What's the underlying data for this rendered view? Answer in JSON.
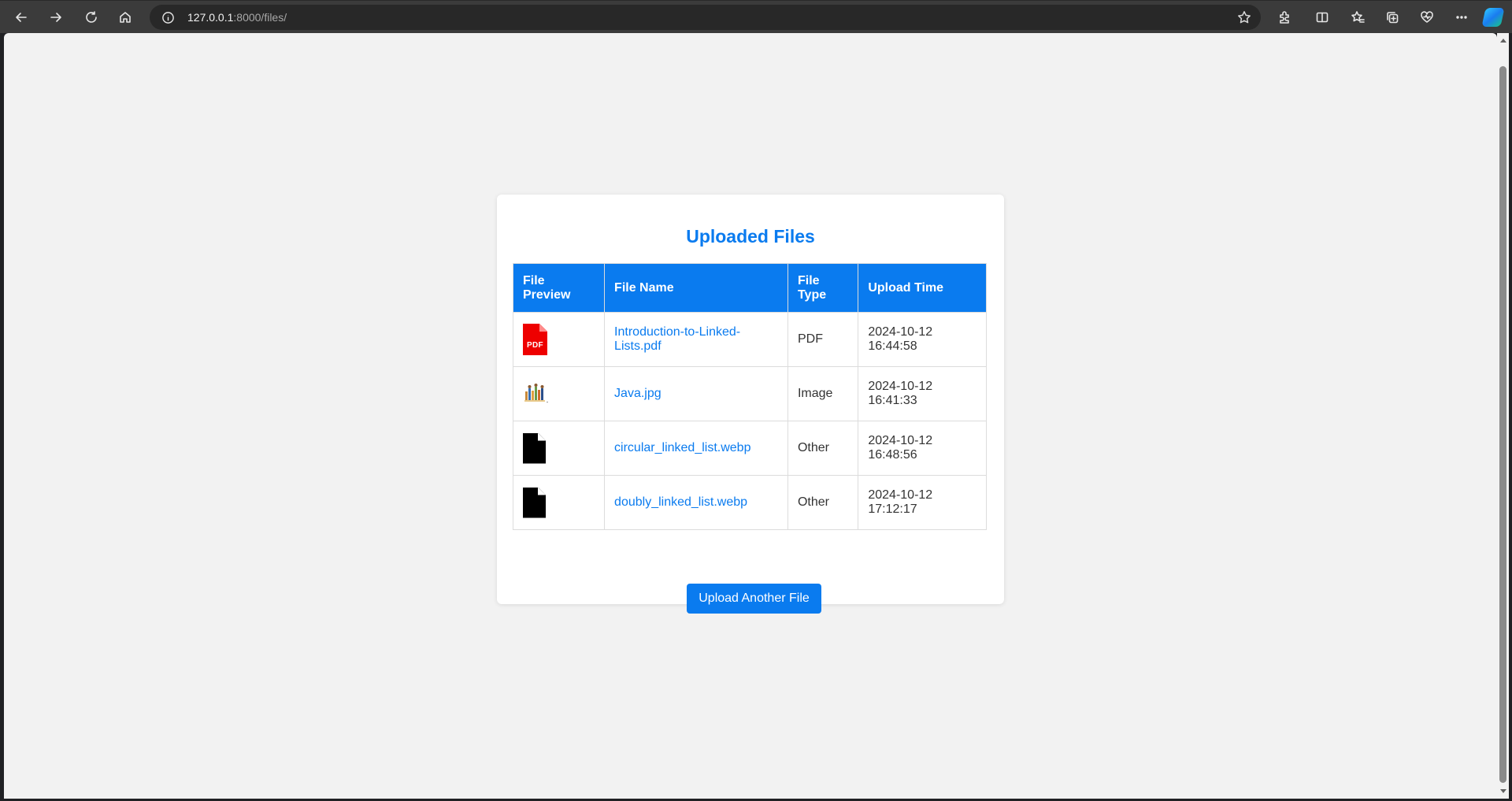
{
  "browser": {
    "url_host": "127.0.0.1",
    "url_rest": ":8000/files/",
    "icons": [
      "back-icon",
      "forward-icon",
      "refresh-icon",
      "home-icon",
      "info-icon",
      "favorite-star-icon",
      "extensions-icon",
      "split-screen-icon",
      "favorites-icon",
      "collections-icon",
      "browser-essentials-icon",
      "more-icon",
      "copilot-icon"
    ]
  },
  "page": {
    "title": "Uploaded Files",
    "columns": [
      "File Preview",
      "File Name",
      "File Type",
      "Upload Time"
    ],
    "rows": [
      {
        "preview": "pdf-icon",
        "name": "Introduction-to-Linked-Lists.pdf",
        "type": "PDF",
        "time": "2024-10-12 16:44:58"
      },
      {
        "preview": "image-thumbnail",
        "name": "Java.jpg",
        "type": "Image",
        "time": "2024-10-12 16:41:33"
      },
      {
        "preview": "file-icon",
        "name": "circular_linked_list.webp",
        "type": "Other",
        "time": "2024-10-12 16:48:56"
      },
      {
        "preview": "file-icon",
        "name": "doubly_linked_list.webp",
        "type": "Other",
        "time": "2024-10-12 17:12:17"
      }
    ],
    "upload_button": "Upload Another File",
    "colors": {
      "accent": "#0a7bef",
      "pdf": "#ee0000",
      "background": "#f2f2f2"
    }
  }
}
